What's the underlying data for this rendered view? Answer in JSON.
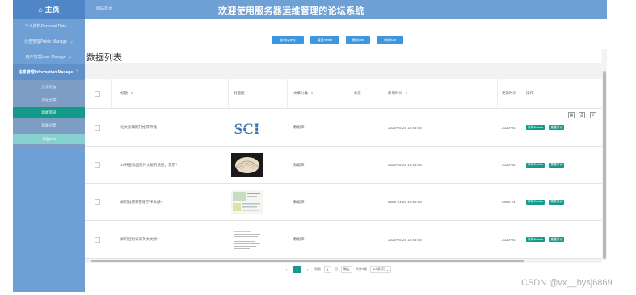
{
  "app": {
    "home_label": "主页",
    "title": "欢迎使用服务器运维管理的论坛系统",
    "top_link": "网站首页"
  },
  "sidebar": {
    "items": [
      {
        "label": "个人资料Personal Data"
      },
      {
        "label": "公告管理Public Manage"
      },
      {
        "label": "用户管理User Manage"
      },
      {
        "label": "信息管理Information Manage"
      }
    ],
    "sub_items": [
      {
        "label": "交流论坛"
      },
      {
        "label": "论坛分类"
      },
      {
        "label": "新闻资讯"
      },
      {
        "label": "新闻分类"
      },
      {
        "label": "退出Exit"
      }
    ]
  },
  "toolbar": {
    "query": "查询Query",
    "reset": "重置Reset",
    "delete": "删除Del",
    "add": "新增Add"
  },
  "list_title": "数据列表",
  "table_icons": [
    "grid-icon",
    "print-icon",
    "export-icon"
  ],
  "columns": [
    "标题",
    "封面图",
    "文章分类",
    "标签",
    "新增时间",
    "更新时间",
    "操作"
  ],
  "rows": [
    {
      "title": "论文投稿期刊推荐神器",
      "category": "数据库",
      "tag": "",
      "created": "2023-04-28 16:59:08",
      "updated": "2023-04",
      "thumb": "sci-logo"
    },
    {
      "title": "19种查找国内外文献的途径，实用！",
      "category": "数据库",
      "tag": "",
      "created": "2023-04-28 16:59:08",
      "updated": "2023-04",
      "thumb": "shell-photo"
    },
    {
      "title": "如何总结和整理学术文献?",
      "category": "数据库",
      "tag": "",
      "created": "2023-04-28 16:59:08",
      "updated": "2023-04",
      "thumb": "document-collage"
    },
    {
      "title": "如何轻松订阅英文文献?",
      "category": "数据库",
      "tag": "",
      "created": "2023-04-28 16:59:08",
      "updated": "2023-04",
      "thumb": "text-page"
    }
  ],
  "actions": {
    "detail": "详情Details",
    "review": "查看评论"
  },
  "pagination": {
    "current": "1",
    "goto_label": "到第",
    "goto_value": "1",
    "page_unit": "页",
    "confirm": "确定",
    "total": "共计4条",
    "page_size": "10 条/页"
  },
  "watermark": "CSDN @vx__bysj6869",
  "colors": {
    "sidebar": "#6fa0d5",
    "topbar": "#6fa0d5",
    "accent": "#149a8a",
    "button": "#3d97de"
  }
}
